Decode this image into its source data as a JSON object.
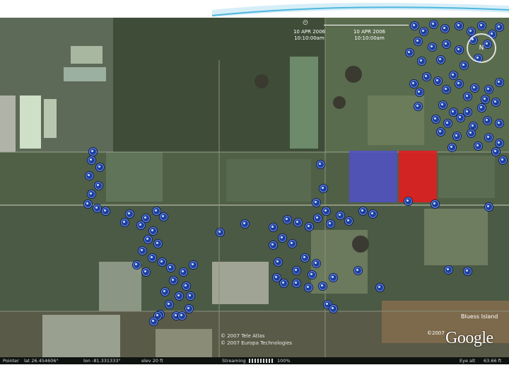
{
  "time_slider": {
    "start_date": "10 APR 2006",
    "start_time": "10:10:00am",
    "end_date": "10 APR 2006",
    "end_time": "10:10:00am",
    "clock_icon": "clock-icon"
  },
  "compass": {
    "icon": "compass-icon",
    "north_label": "N"
  },
  "place_label": "Bluess Island",
  "copyright": [
    "© 2007 Tele Atlas",
    "© 2007 Europa Technologies"
  ],
  "logo_text": "Google",
  "logo_mark": "©2007",
  "status": {
    "pointer": "Pointer",
    "lat": "lat  26.454606°",
    "lon": "lon  -81.331333°",
    "elev": "elev  20 ft",
    "streaming_label": "Streaming",
    "streaming_value": "100%",
    "eye_alt": "Eye alt",
    "eye_alt_value": "63.66 ft"
  },
  "overlays": {
    "blue_area_color": "#5050c8",
    "red_area_color": "#e01e1e",
    "marker_color": "#1d3f9e"
  }
}
